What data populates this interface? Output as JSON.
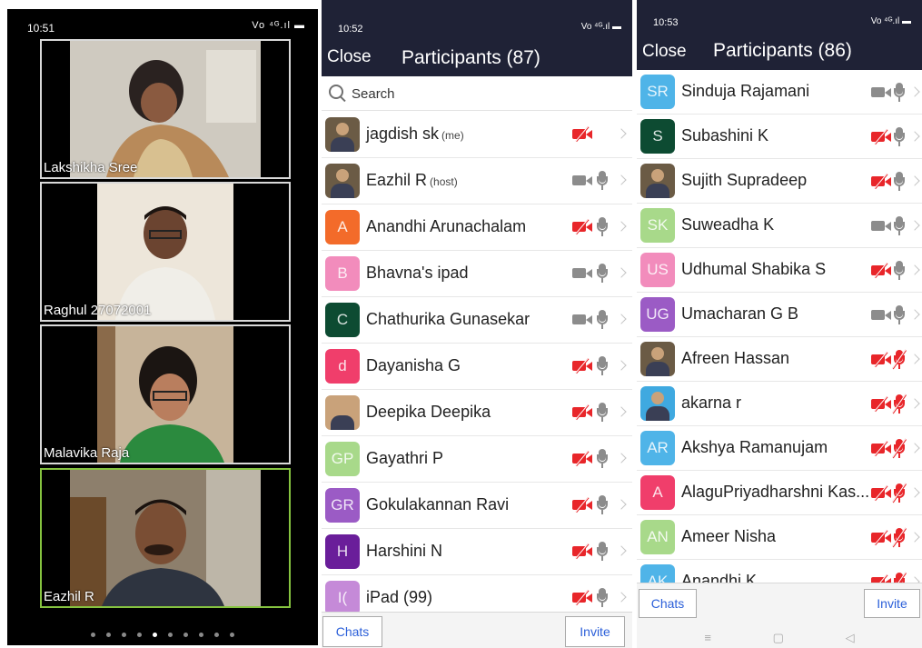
{
  "colors": {
    "red": "#e8262a",
    "gray": "#8c8c8c",
    "topbar": "#1f2236",
    "accent_green": "#86c440",
    "link_blue": "#2b5fd9"
  },
  "gallery": {
    "status": {
      "time": "10:51",
      "icons": "Vo ⁴ᴳ.ıl ▬"
    },
    "tiles": [
      {
        "name": "Lakshikha Sree",
        "active": false
      },
      {
        "name": "Raghul 27072001",
        "active": false
      },
      {
        "name": "Malavika Raja",
        "active": false
      },
      {
        "name": "Eazhil R",
        "active": true
      }
    ],
    "dots": [
      false,
      false,
      false,
      false,
      true,
      false,
      false,
      false,
      false,
      false
    ]
  },
  "list1": {
    "status": {
      "time": "10:52",
      "icons": "Vo ⁴ᴳ.ıl ▬"
    },
    "close_label": "Close",
    "title": "Participants (87)",
    "search_label": "Search",
    "participants": [
      {
        "name": "jagdish sk",
        "tag": "(me)",
        "avatar": "photo",
        "avatar_text": "",
        "color": "#6b5b45",
        "cam": "off",
        "mic": "none"
      },
      {
        "name": "Eazhil R",
        "tag": "(host)",
        "avatar": "photo",
        "avatar_text": "",
        "color": "#6b5b45",
        "cam": "on",
        "mic": "on"
      },
      {
        "name": "Anandhi Arunachalam",
        "tag": "",
        "avatar": "letter",
        "avatar_text": "A",
        "color": "#f36b2a",
        "cam": "off",
        "mic": "on"
      },
      {
        "name": "Bhavna's ipad",
        "tag": "",
        "avatar": "letter",
        "avatar_text": "B",
        "color": "#f28cbc",
        "cam": "on",
        "mic": "on"
      },
      {
        "name": "Chathurika Gunasekar",
        "tag": "",
        "avatar": "letter",
        "avatar_text": "C",
        "color": "#0d4b32",
        "cam": "on",
        "mic": "on"
      },
      {
        "name": "Dayanisha G",
        "tag": "",
        "avatar": "letter",
        "avatar_text": "d",
        "color": "#f03e6b",
        "cam": "off",
        "mic": "on"
      },
      {
        "name": "Deepika Deepika",
        "tag": "",
        "avatar": "photo",
        "avatar_text": "",
        "color": "#c9a27a",
        "cam": "off",
        "mic": "on"
      },
      {
        "name": "Gayathri P",
        "tag": "",
        "avatar": "letter",
        "avatar_text": "GP",
        "color": "#a8d98a",
        "cam": "off",
        "mic": "on"
      },
      {
        "name": "Gokulakannan Ravi",
        "tag": "",
        "avatar": "letter",
        "avatar_text": "GR",
        "color": "#9b5bc5",
        "cam": "off",
        "mic": "on"
      },
      {
        "name": "Harshini N",
        "tag": "",
        "avatar": "letter",
        "avatar_text": "H",
        "color": "#6a1e9a",
        "cam": "off",
        "mic": "on"
      },
      {
        "name": "iPad (99)",
        "tag": "",
        "avatar": "letter",
        "avatar_text": "I(",
        "color": "#c58ad8",
        "cam": "off",
        "mic": "on"
      }
    ],
    "chats_label": "Chats",
    "invite_label": "Invite"
  },
  "list2": {
    "status": {
      "time": "10:53",
      "icons": "Vo ⁴ᴳ.ıl ▬"
    },
    "close_label": "Close",
    "title": "Participants (86)",
    "participants": [
      {
        "name": "Sinduja Rajamani",
        "avatar": "letter",
        "avatar_text": "SR",
        "color": "#4fb4e8",
        "cam": "on",
        "mic": "on"
      },
      {
        "name": "Subashini K",
        "avatar": "letter",
        "avatar_text": "S",
        "color": "#0d4b32",
        "cam": "off",
        "mic": "on"
      },
      {
        "name": "Sujith Supradeep",
        "avatar": "photo",
        "avatar_text": "",
        "color": "#6b5b45",
        "cam": "off",
        "mic": "on"
      },
      {
        "name": "Suweadha K",
        "avatar": "letter",
        "avatar_text": "SK",
        "color": "#a8d98a",
        "cam": "on",
        "mic": "on"
      },
      {
        "name": "Udhumal Shabika S",
        "avatar": "letter",
        "avatar_text": "US",
        "color": "#f28cbc",
        "cam": "off",
        "mic": "on"
      },
      {
        "name": "Umacharan G B",
        "avatar": "letter",
        "avatar_text": "UG",
        "color": "#9b5bc5",
        "cam": "on",
        "mic": "on"
      },
      {
        "name": "Afreen Hassan",
        "avatar": "photo",
        "avatar_text": "",
        "color": "#6b5b45",
        "cam": "off",
        "mic": "muted"
      },
      {
        "name": "akarna r",
        "avatar": "photo",
        "avatar_text": "",
        "color": "#3fa9e0",
        "cam": "off",
        "mic": "muted"
      },
      {
        "name": "Akshya Ramanujam",
        "avatar": "letter",
        "avatar_text": "AR",
        "color": "#4fb4e8",
        "cam": "off",
        "mic": "muted"
      },
      {
        "name": "AlaguPriyadharshni Kas...",
        "avatar": "letter",
        "avatar_text": "A",
        "color": "#f03e6b",
        "cam": "off",
        "mic": "muted"
      },
      {
        "name": "Ameer Nisha",
        "avatar": "letter",
        "avatar_text": "AN",
        "color": "#a8d98a",
        "cam": "off",
        "mic": "muted"
      },
      {
        "name": "Anandhi K",
        "avatar": "letter",
        "avatar_text": "AK",
        "color": "#4fb4e8",
        "cam": "off",
        "mic": "muted"
      }
    ],
    "chats_label": "Chats",
    "invite_label": "Invite",
    "nav_keys": [
      "≡",
      "▢",
      "◁"
    ]
  }
}
